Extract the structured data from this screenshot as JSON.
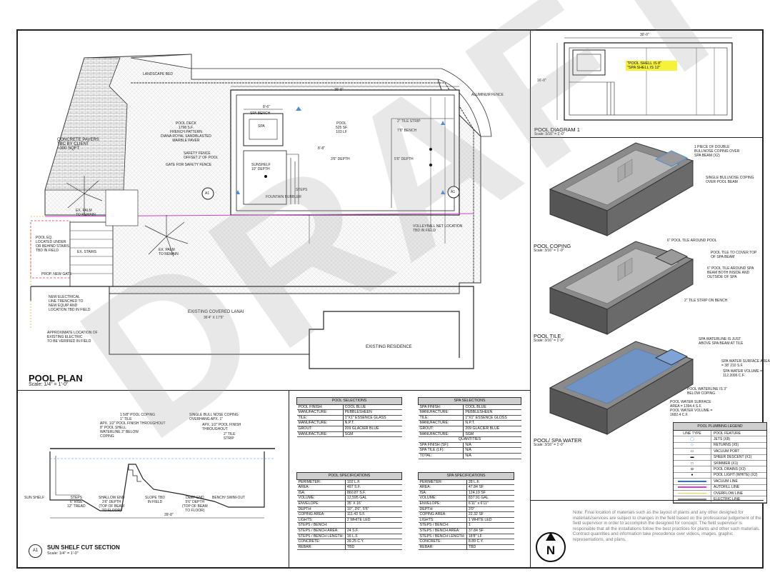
{
  "watermark": "DRAFT",
  "pool_plan": {
    "title": "POOL PLAN",
    "scale": "Scale: 1/4\" = 1'-0\"",
    "labels": {
      "landscape_bed": "LANDSCAPE BED",
      "aluminum_fence": "ALUMINUM FENCE",
      "pool_deck": "POOL DECK\n1798 S.F.\nFRENCH PATTERN\nDIANA ROYAL SANDBLASTED\nMARBLE PAVER",
      "concrete_pavers": "CONCRETE PAVERS\nTBC BY CLIENT\n~300 SQFT",
      "safety_fence": "SAFETY FENCE\nOFFSET 2' OF POOL",
      "gate": "GATE FOR SAFETY FENCE",
      "spa_bench": "SPA BENCH",
      "spa": "SPA",
      "pool": "POOL\n525 SF\n103 LF",
      "tile_strip": "2\" TILE STRIP",
      "bench": "7'6\" BENCH",
      "sunshelf": "SUNSHELF\n10\" DEPTH",
      "fountain": "FOUNTAIN BUBBLER",
      "steps": "STEPS",
      "depth_36": "3'6\" DEPTH",
      "depth_56": "5'6\" DEPTH",
      "palm": "EX. PALM\nTO REMAIN",
      "palm2": "EX. PALM\nTO REMAIN",
      "pool_eq": "POOL EQ.\nLOCATED UNDER\nOR BEHIND STAIRS\nTBD IN FIELD",
      "ex_stairs": "EX. STAIRS",
      "volleyball": "VOLLEYBALL NET LOCATION\nTBD IN FIELD",
      "new_gate": "PROP. NEW GATE",
      "electrical": "NEW ELECTRICAL\nLINE TRENCHED TO\nNEW EQUIP AND\nLOCATION TBD IN FIELD",
      "approx": "APPROXIMATE LOCATION OF\nEXISTING ELECTRIC\nTO BE VERIFIED IN FIELD",
      "lanai": "EXISTING COVERED LANAI",
      "lanai_dim": "36'4\" X 17'6\"",
      "residence": "EXISTING RESIDENCE",
      "dim_top": "39'-8\"",
      "dim_spa": "8'-6\"",
      "dim_sun": "8'-8\"",
      "a1": "A1",
      "a1b": "A1"
    }
  },
  "sun_shelf_section": {
    "title": "SUN SHELF CUT SECTION",
    "scale": "Scale: 1/4\" = 1'-0\"",
    "marker": "A1",
    "labels": {
      "l1": "1 5/8\" POOL COPING",
      "l2": "1\" TILE",
      "l3": "APX. 1/2\" POOL FINISH THROUGHOUT",
      "l4": "8\" POOL SHELL",
      "l5": "WATERLINE 3\" BELOW\nCOPING",
      "r1": "SINGLE BULL NOSE COPING\nOVERHANG APX. 1\"",
      "r2": "APX. 1/2\" POOL FINISH\nTHROUGHOUT",
      "r3": "2\" TILE\nSTRIP",
      "b1": "SUN SHELF",
      "b2": "STEPS\n6\" RISE\n12\" TREAD",
      "b3": "SHALLOW END\n3'6\" DEPTH\n(TOP OF BEAM\nTO FLOOR)",
      "b4": "SLOPE TBD\nIN FIELD",
      "b5": "DEEP END\n5'6\" DEPTH\n(TOP OF BEAM\nTO FLOOR)",
      "b6": "BENCH/ SWIM-OUT",
      "dim": "39'-8\""
    }
  },
  "pool_selections": {
    "header": "POOL SELECTIONS",
    "rows": [
      [
        "POOL FINISH:",
        "COOL BLUE"
      ],
      [
        "MANUFACTURE:",
        "PEBBLESHEEN"
      ],
      [
        "TILE:",
        "1\"X1\" ESSENCE GLASS"
      ],
      [
        "MANUFACTURE:",
        "N.P.T."
      ],
      [
        "GROUT:",
        "209 GLACIER BLUE"
      ],
      [
        "MANUFACTURE:",
        "SGM"
      ]
    ]
  },
  "spa_selections": {
    "header": "SPA SELECTIONS",
    "rows": [
      [
        "SPA FINISH:",
        "COOL BLUE"
      ],
      [
        "MANUFACTURE:",
        "PEBBLESHEEN"
      ],
      [
        "TILE:",
        "1\"X1\" ESSENCE GLOSS"
      ],
      [
        "MANUFACTURE:",
        "N.P.T."
      ],
      [
        "GROUT:",
        "209 GLACIER BLUE"
      ],
      [
        "MANUFACTURE:",
        "SGM"
      ]
    ],
    "quantities_header": "QUANTITIES",
    "quantities": [
      [
        "SPA FINISH (SF):",
        "N/A"
      ],
      [
        "SPA TILE (LF):",
        "N/A"
      ],
      [
        "TOTAL:",
        "N/A"
      ]
    ]
  },
  "pool_specifications": {
    "header": "POOL SPECIFICATIONS",
    "rows": [
      [
        "PERIMETER:",
        "102 L.F."
      ],
      [
        "AREA:",
        "497 S.F."
      ],
      [
        "ISA:",
        "860.87 S.F."
      ],
      [
        "VOLUME:",
        "12,595 GAL"
      ],
      [
        "ENVELOPE:",
        "35' X 16'"
      ],
      [
        "DEPTH:",
        "10\", 3'6\", 5'6\""
      ],
      [
        "COPING AREA:",
        "111.43 S.F."
      ],
      [
        "LIGHTS:",
        "2 WHITE LED"
      ],
      [
        "STEPS / BENCH:",
        ""
      ],
      [
        "STEPS / BENCH AREA:",
        "24 S.F."
      ],
      [
        "STEPS / BENCH LENGTH:",
        "16 L.F."
      ],
      [
        "CONCRETE:",
        "39.25 C.Y."
      ],
      [
        "REBAR:",
        "TBD"
      ]
    ]
  },
  "spa_specifications": {
    "header": "SPA SPECIFICATIONS",
    "rows": [
      [
        "PERIMETER:",
        "28 L.F."
      ],
      [
        "AREA:",
        "47.84 SF"
      ],
      [
        "ISA:",
        "124.19 SF"
      ],
      [
        "VOLUME:",
        "837.91 GAL"
      ],
      [
        "ENVELOPE:",
        "6'11\" x 6'11\""
      ],
      [
        "DEPTH:",
        "3'0\""
      ],
      [
        "COPING AREA:",
        "22.32 SF"
      ],
      [
        "LIGHTS:",
        "1 WHITE LED"
      ],
      [
        "STEPS / BENCH:",
        "1"
      ],
      [
        "STEPS / BENCH AREA:",
        "37.84 SF"
      ],
      [
        "STEPS / BENCH LENGTH:",
        "18'8\" LF"
      ],
      [
        "CONCRETE:",
        "8.89 C.Y."
      ],
      [
        "REBAR:",
        "TBD"
      ]
    ]
  },
  "pool_diagram": {
    "title": "POOL DIAGRAM 1",
    "scale": "Scale: 3/16\" = 1'-0\"",
    "highlight": "\"POOL SHELL IS 8\"\n\"SPA SHELL IS 12\"",
    "dim_top": "30'-0\"",
    "dim_left": "16'-0\""
  },
  "pool_coping": {
    "title": "POOL COPING",
    "scale": "Scale: 3/16\" = 1'-0\"",
    "labels": {
      "a": "1 PIECE OF DOUBLE\nBULLNOSE COPING OVER\nSPA BEAM (X2)",
      "b": "SINGLE BULLNOSE COPING\nOVER POOL BEAM"
    }
  },
  "pool_tile": {
    "title": "POOL TILE",
    "scale": "Scale: 3/16\" = 1'-0\"",
    "labels": {
      "a": "6\" POOL TILE AROUND POOL",
      "b": "POOL TILE TO COVER TOP\nOF SPA BEAM",
      "c": "6\" POOL TILE AROUND SPA\nBEAM BOTH INSIDE AND\nOUTSIDE OF SPA",
      "d": "2\" TILE STRIP ON BENCH"
    }
  },
  "pool_spa_water": {
    "title": "POOL/ SPA WATER",
    "scale": "Scale: 3/16\" = 1'-0\"",
    "labels": {
      "a": "SPA WATERLINE IS JUST\nABOVE SPA BEAM AT TILE",
      "b": "SPA WATER SURFACE AREA\n= 38' 210 S.F.",
      "c": "SPA WATER VOLUME =\n112.2096 C.F.",
      "d": "POOL WATERLINE IS 3\"\nBELOW COPING",
      "e": "POOL WATER SURFACE\nAREA = 1394.4 S.F.\nPOOL WATER VOLUME =\n1682.4 C.F."
    }
  },
  "plumbing_legend": {
    "header": "POOL PLUMBING LEGEND",
    "col_type": "LINE TYPE",
    "col_feature": "POOL FEATURE",
    "rows": [
      {
        "sym": "◯",
        "name": "JETS (X8)",
        "color": "#4a8fd8"
      },
      {
        "sym": "◇",
        "name": "RETURNS (X5)",
        "color": "#4a8fd8"
      },
      {
        "sym": "▭",
        "name": "VACUUM PORT",
        "color": "#000000"
      },
      {
        "sym": "▬",
        "name": "SHEER DESCENT (X1)",
        "color": "#000000"
      },
      {
        "sym": "□",
        "name": "SKIMMER (X1)",
        "color": "#000000"
      },
      {
        "sym": "◘",
        "name": "POOL DRAINS (X3)",
        "color": "#000000"
      },
      {
        "sym": "●",
        "name": "POOL LIGHT (WHITE) (X2)",
        "color": "#000000"
      },
      {
        "sym": "",
        "name": "VACUUM LINE",
        "color": "#2a6fd8"
      },
      {
        "sym": "",
        "name": "AUTOFILL LINE",
        "color": "#d040d0"
      },
      {
        "sym": "",
        "name": "OVERFLOW LINE",
        "color": "#e8d040"
      },
      {
        "sym": "",
        "name": "ELECTRIC LINE",
        "color": "#888888"
      }
    ]
  },
  "note": "Note: Final location of materials such as the layout of plants and any other designed for materials/services are subject to changes in the field based on the professional judgement of the field supervisor in order to accomplish the designed for concept. The field supervisor is responsible that all the installations follow the best practices for plants and other such materials. Contract quantities and information take precedence over videos, images, graphic representations, and plans.",
  "north": "N",
  "colors": {
    "accent_blue": "#4a8fd8",
    "water": "#6f93c4",
    "highlight": "#f6f23a"
  }
}
